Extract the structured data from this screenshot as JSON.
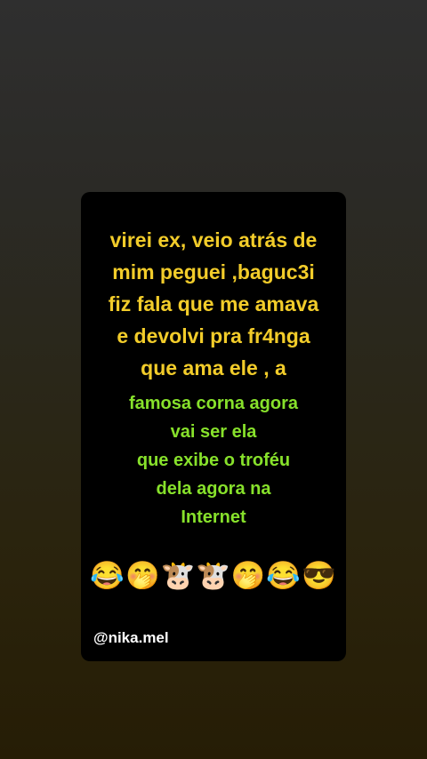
{
  "post": {
    "yellow_lines": [
      "virei ex, veio atrás de",
      "mim peguei ,baguc3i",
      "fiz fala que me amava",
      "e devolvi pra fr4nga",
      "que ama ele , a"
    ],
    "green_lines": [
      "famosa corna agora",
      "vai ser ela",
      "que exibe o troféu",
      "dela agora na",
      "Internet"
    ],
    "emojis": "😂🤭🐮🐮🤭😂😎",
    "handle": "@nika.mel"
  },
  "colors": {
    "card_background": "#000000",
    "yellow_text": "#f2cc2a",
    "green_text": "#87e12b",
    "handle_text": "#ffffff"
  }
}
